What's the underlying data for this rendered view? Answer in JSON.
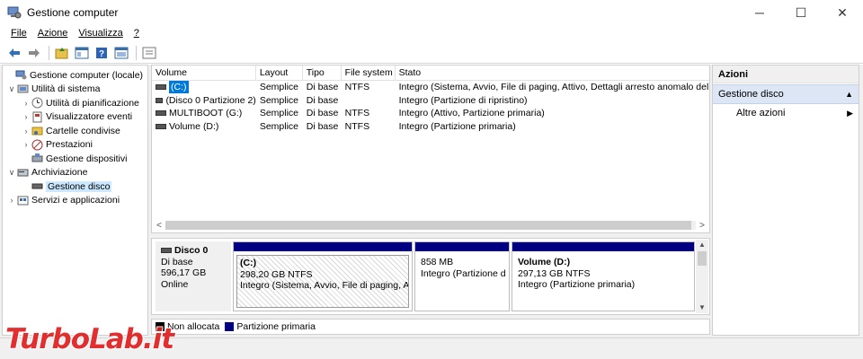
{
  "window": {
    "title": "Gestione computer",
    "controls": {
      "minimize": "─",
      "maximize": "☐",
      "close": "✕"
    }
  },
  "menubar": {
    "items": [
      {
        "label": "File"
      },
      {
        "label": "Azione"
      },
      {
        "label": "Visualizza"
      },
      {
        "label": "?"
      }
    ]
  },
  "toolbar": {
    "buttons": [
      "back-icon",
      "forward-icon",
      "up-folder-icon",
      "console-tree-icon",
      "help-icon",
      "properties-icon",
      "show-hide-icon"
    ]
  },
  "tree": {
    "items": [
      {
        "label": "Gestione computer (locale)",
        "level": 0,
        "expander": "",
        "icon": "computer-management-icon"
      },
      {
        "label": "Utilità di sistema",
        "level": 1,
        "expander": "∨",
        "icon": "system-tools-icon"
      },
      {
        "label": "Utilità di pianificazione",
        "level": 2,
        "expander": "›",
        "icon": "task-scheduler-icon"
      },
      {
        "label": "Visualizzatore eventi",
        "level": 2,
        "expander": "›",
        "icon": "event-viewer-icon"
      },
      {
        "label": "Cartelle condivise",
        "level": 2,
        "expander": "›",
        "icon": "shared-folders-icon"
      },
      {
        "label": "Prestazioni",
        "level": 2,
        "expander": "›",
        "icon": "performance-icon"
      },
      {
        "label": "Gestione dispositivi",
        "level": 2,
        "expander": "",
        "icon": "device-manager-icon"
      },
      {
        "label": "Archiviazione",
        "level": 1,
        "expander": "∨",
        "icon": "storage-icon"
      },
      {
        "label": "Gestione disco",
        "level": 2,
        "expander": "",
        "icon": "disk-management-icon",
        "selected": true
      },
      {
        "label": "Servizi e applicazioni",
        "level": 1,
        "expander": "›",
        "icon": "services-icon"
      }
    ]
  },
  "volumes": {
    "headers": [
      "Volume",
      "Layout",
      "Tipo",
      "File system",
      "Stato"
    ],
    "rows": [
      {
        "volume": "(C:)",
        "layout": "Semplice",
        "tipo": "Di base",
        "fs": "NTFS",
        "stato": "Integro (Sistema, Avvio, File di paging, Attivo, Dettagli arresto anomalo del s",
        "selected": true
      },
      {
        "volume": "(Disco 0 Partizione 2)",
        "layout": "Semplice",
        "tipo": "Di base",
        "fs": "",
        "stato": "Integro (Partizione di ripristino)"
      },
      {
        "volume": "MULTIBOOT (G:)",
        "layout": "Semplice",
        "tipo": "Di base",
        "fs": "NTFS",
        "stato": "Integro (Attivo, Partizione primaria)"
      },
      {
        "volume": "Volume (D:)",
        "layout": "Semplice",
        "tipo": "Di base",
        "fs": "NTFS",
        "stato": "Integro (Partizione primaria)"
      }
    ],
    "scroll_left": "<",
    "scroll_right": ">"
  },
  "disk": {
    "name": "Disco 0",
    "type": "Di base",
    "size": "596,17 GB",
    "status": "Online",
    "partitions": [
      {
        "name": "(C:)",
        "size": "298,20 GB NTFS",
        "status": "Integro (Sistema, Avvio, File di paging, Atti"
      },
      {
        "name": "",
        "size": "858 MB",
        "status": "Integro (Partizione di"
      },
      {
        "name": "Volume  (D:)",
        "size": "297,13 GB NTFS",
        "status": "Integro (Partizione primaria)"
      }
    ]
  },
  "legend": {
    "items": [
      {
        "label": "Non allocata",
        "color": "#000000"
      },
      {
        "label": "Partizione primaria",
        "color": "#000080"
      }
    ]
  },
  "actions": {
    "header": "Azioni",
    "section": "Gestione disco",
    "section_arrow": "▲",
    "items": [
      {
        "label": "Altre azioni",
        "arrow": "▶"
      }
    ]
  },
  "watermark": {
    "text": "TurboLab.it"
  },
  "colors": {
    "accent": "#0078d7",
    "partition_bar": "#000080",
    "actions_section": "#dce6f4",
    "watermark": "#e01e1e"
  }
}
